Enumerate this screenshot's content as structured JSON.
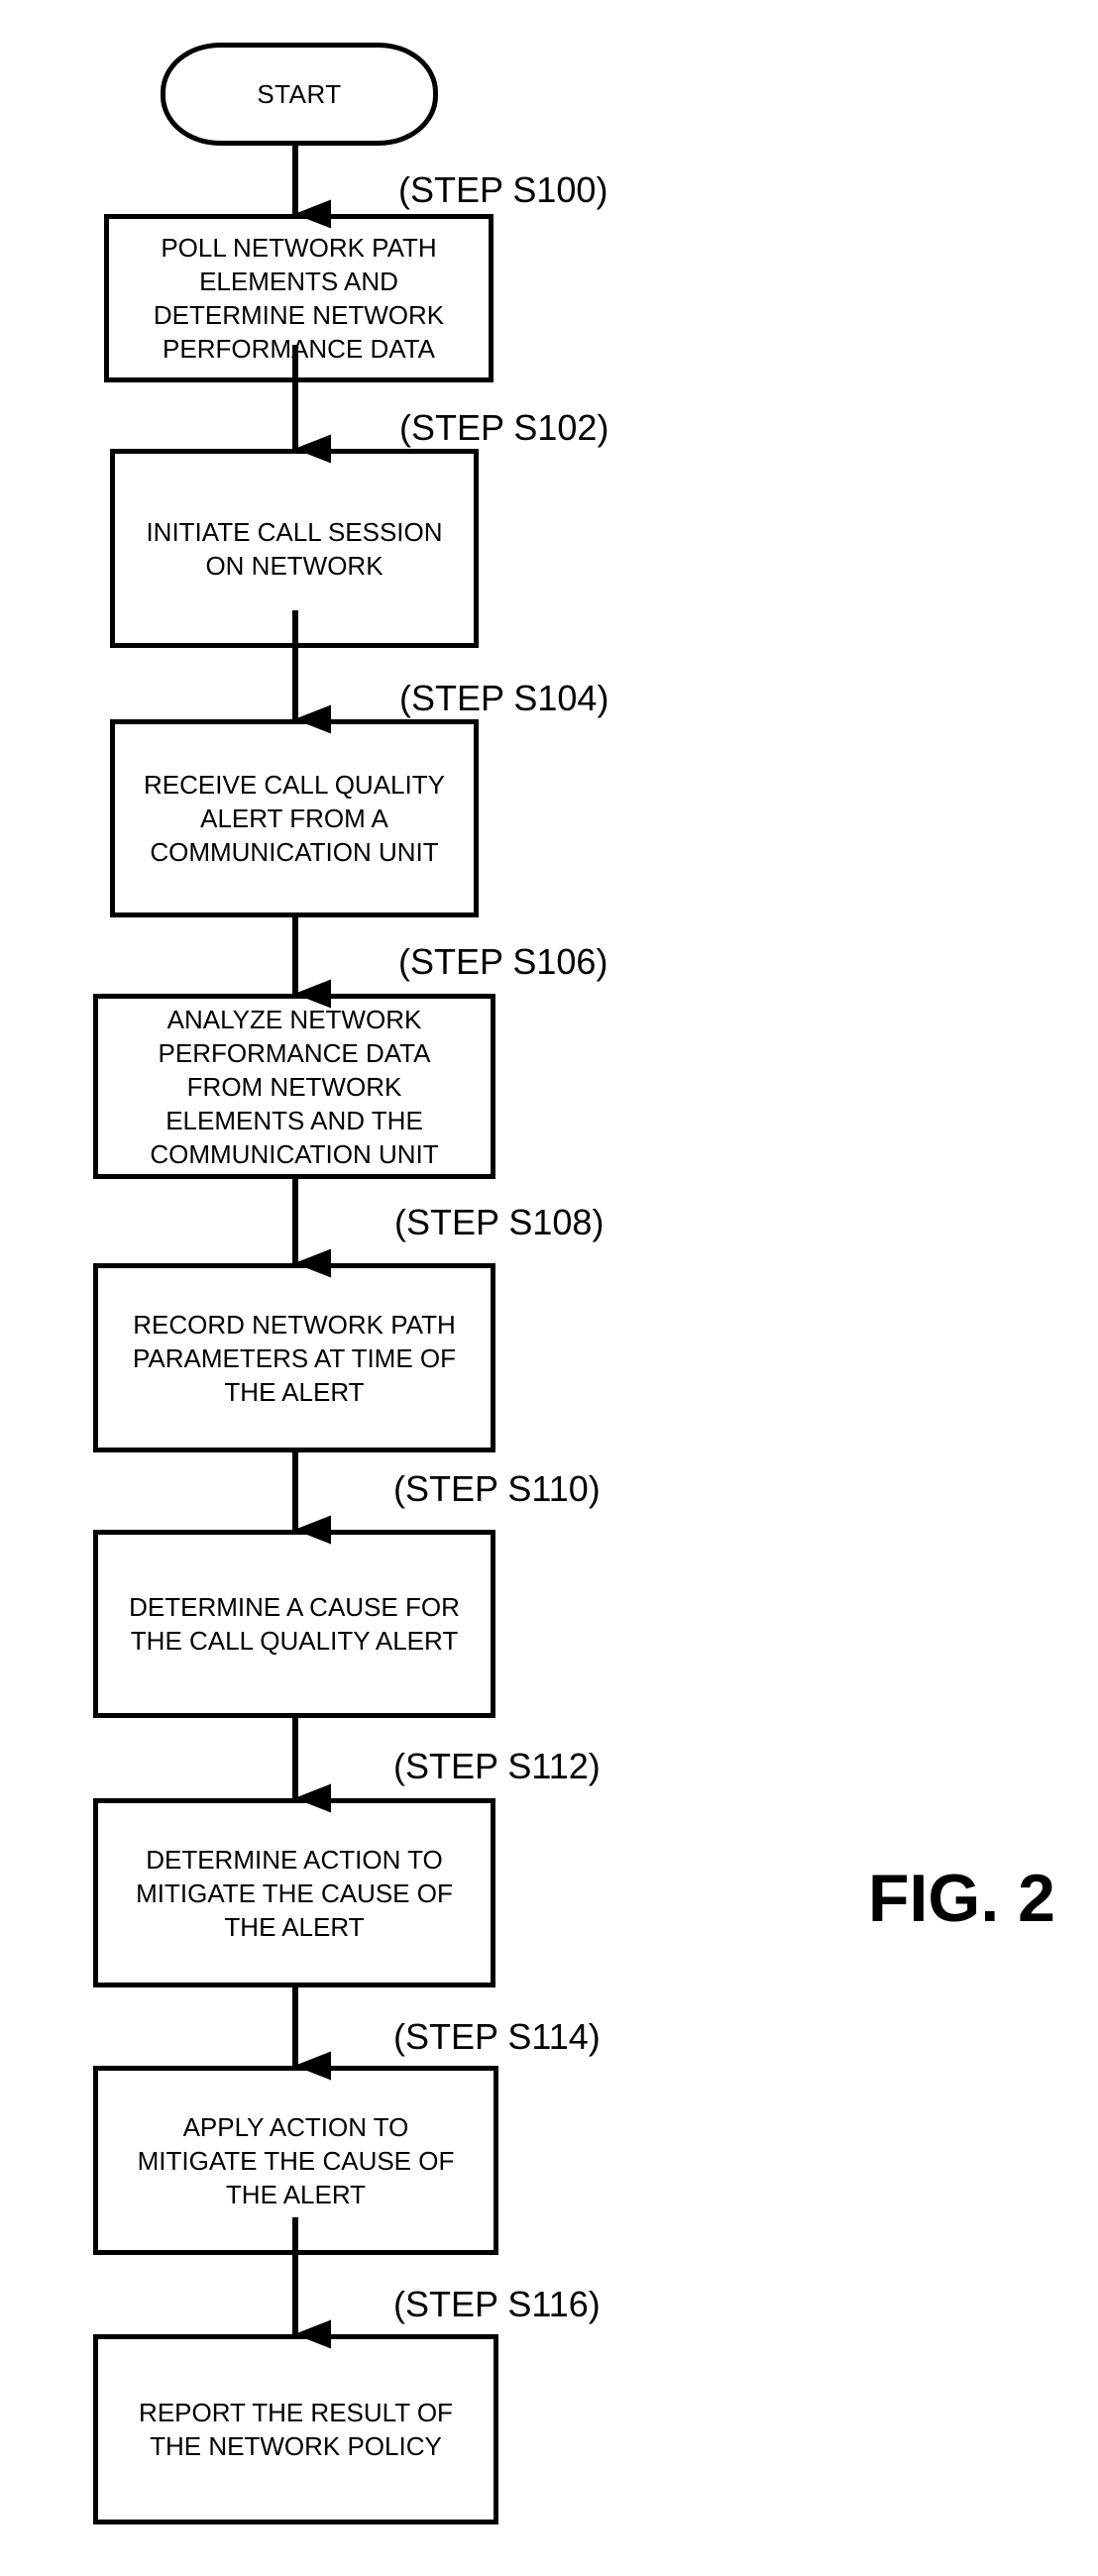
{
  "figure_label": "FIG. 2",
  "start": {
    "label": "START"
  },
  "steps": [
    {
      "id": "S100",
      "label": "(STEP S100)",
      "text": "POLL NETWORK PATH\nELEMENTS AND\nDETERMINE NETWORK\nPERFORMANCE DATA"
    },
    {
      "id": "S102",
      "label": "(STEP S102)",
      "text": "INITIATE CALL SESSION\nON NETWORK"
    },
    {
      "id": "S104",
      "label": "(STEP S104)",
      "text": "RECEIVE CALL QUALITY\nALERT FROM A\nCOMMUNICATION UNIT"
    },
    {
      "id": "S106",
      "label": "(STEP S106)",
      "text": "ANALYZE NETWORK\nPERFORMANCE DATA\nFROM NETWORK\nELEMENTS AND THE\nCOMMUNICATION UNIT"
    },
    {
      "id": "S108",
      "label": "(STEP S108)",
      "text": "RECORD NETWORK PATH\nPARAMETERS AT TIME OF\nTHE ALERT"
    },
    {
      "id": "S110",
      "label": "(STEP S110)",
      "text": "DETERMINE A CAUSE FOR\nTHE CALL QUALITY ALERT"
    },
    {
      "id": "S112",
      "label": "(STEP S112)",
      "text": "DETERMINE ACTION TO\nMITIGATE THE CAUSE OF\nTHE ALERT"
    },
    {
      "id": "S114",
      "label": "(STEP S114)",
      "text": "APPLY ACTION TO\nMITIGATE THE CAUSE OF\nTHE ALERT"
    },
    {
      "id": "S116",
      "label": "(STEP S116)",
      "text": "REPORT THE RESULT OF\nTHE NETWORK POLICY"
    }
  ]
}
